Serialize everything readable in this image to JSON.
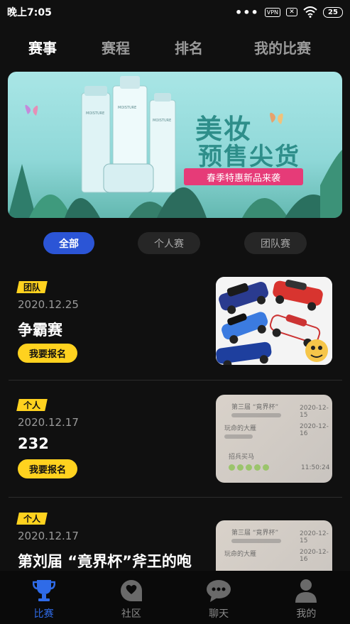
{
  "status_bar": {
    "time": "晚上7:05",
    "vpn": "VPN",
    "battery": "25"
  },
  "top_tabs": [
    {
      "label": "赛事",
      "active": true
    },
    {
      "label": "赛程",
      "active": false
    },
    {
      "label": "排名",
      "active": false
    },
    {
      "label": "我的比赛",
      "active": false
    }
  ],
  "banner": {
    "title_line1": "美妆",
    "title_line2": "预售尖货",
    "ribbon": "春季特惠新品来袭",
    "product_brand": "MOISTURE TONER"
  },
  "filters": [
    {
      "label": "全部",
      "active": true
    },
    {
      "label": "个人赛",
      "active": false
    },
    {
      "label": "团队赛",
      "active": false
    }
  ],
  "events": [
    {
      "tag": "团队",
      "date": "2020.12.25",
      "title": "争霸赛",
      "button": "我要报名",
      "thumb": "toy-race-cars"
    },
    {
      "tag": "个人",
      "date": "2020.12.17",
      "title": "232",
      "button": "我要报名",
      "thumb": "chat-screenshot"
    },
    {
      "tag": "个人",
      "date": "2020.12.17",
      "title": "第刘届 “竟界杯”斧王的咆",
      "button": "",
      "thumb": "chat-screenshot"
    }
  ],
  "thumb_chat": {
    "line1": "第三届 “竟界杯”",
    "line2": "玩命的大雁",
    "line3": "招兵买马",
    "time1": "2020-12-15",
    "time2": "2020-12-16",
    "time3": "11:50:24"
  },
  "bottom_nav": [
    {
      "label": "比赛",
      "icon": "trophy-icon",
      "active": true
    },
    {
      "label": "社区",
      "icon": "community-icon",
      "active": false
    },
    {
      "label": "聊天",
      "icon": "chat-icon",
      "active": false
    },
    {
      "label": "我的",
      "icon": "profile-icon",
      "active": false
    }
  ],
  "colors": {
    "accent": "#2f63e0",
    "tag_yellow": "#ffd21f",
    "background": "#101010"
  }
}
